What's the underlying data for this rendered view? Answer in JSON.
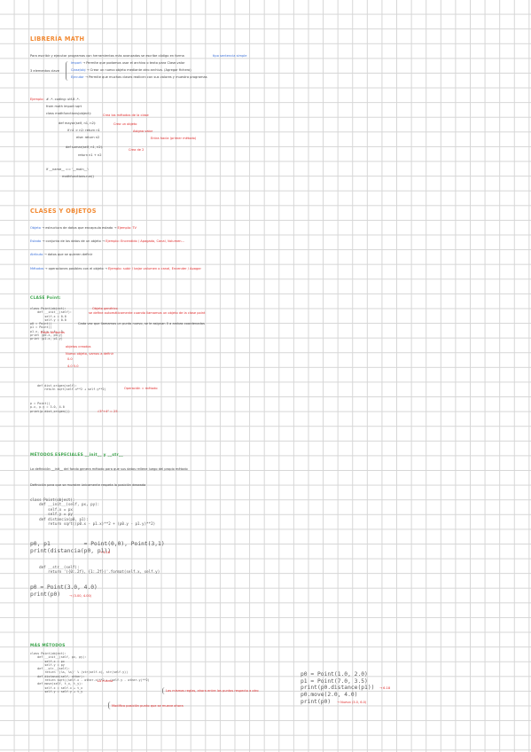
{
  "s1": {
    "title": "LIBRERÍA MATH",
    "intro": "Para escribir y ejecutar programas con herramientas más avanzadas se escribe código en forma",
    "intro_note": "tipo sentencia simple",
    "modules_label": "3 elementos clave",
    "modules": [
      {
        "name": "Import",
        "desc": "Permite que podamos usar el archivo o texto para Clase-valor"
      },
      {
        "name": "Clase/obj",
        "desc": "Crear un nuevo objeto mediante otro archivo. (Agregar fichero)"
      },
      {
        "name": "Ejecutar",
        "desc": "Permite que muchas clases realicen con sus valores y muestra programas"
      }
    ],
    "example_label": "Ejemplo:",
    "example_lines": [
      "# -*- coding: utf-8 -*-",
      "from math import sqrt",
      "class mathfunctions(object):",
      "def mayor(self, n1, n2):",
      "if n1 > n2: return n1",
      "else: return n2",
      "def sumar(self, n1, n2):",
      "return n1 + n2",
      "if __name__ == '__main__':",
      "mathfunctions.run()"
    ],
    "example_notes": [
      "Crea los métodos de la clase",
      "Crea un objeto",
      "Asigna valor",
      "Entra hacia (primer método)",
      "Crea de 2"
    ]
  },
  "s2": {
    "title": "CLASES Y OBJETOS",
    "rows": [
      {
        "term": "Objeto",
        "desc": "estructura de datos que encapsula estado",
        "example": "Ejemplo: TV"
      },
      {
        "term": "Estado",
        "desc": "conjunto de los datos de un objeto",
        "example": "Ejemplo: Encendido / Apagado, Canal, Volumen..."
      },
      {
        "term": "Atributo",
        "desc": "datos que se quieren definir",
        "example": ""
      },
      {
        "term": "Métodos",
        "desc": "operaciones posibles con el objeto",
        "example": "Ejemplo: subir / bajar volumen o canal, Encender / Apagar"
      }
    ]
  },
  "s3": {
    "title": "CLASE Point:",
    "code1": [
      "class Point(object):",
      "    def __init__(self):",
      "        self.x = 0.0",
      "        self.y = 0.0",
      "",
      "p0 = Point()",
      "p1 = Point()",
      "p1.x, p1.y = 4., 5.",
      "print (p0.x, p0.y)",
      "print (p1.x, p1.y)"
    ],
    "notes1": [
      "Objeto genérico",
      "se define automáticamente cuando llamamos un objeto de la clase point",
      "Cada vez que llamamos un punto nuevo, se le asignan 0 a ambas coordenadas",
      "Estos atributos",
      "objetos creados",
      "Nuevo objeto, vamos a definir",
      "0.0",
      "4.0 5.0"
    ],
    "code2": [
      "def dist_origen(self):",
      "    return sqrt(self.x**2 + self.y**2)"
    ],
    "note2": "Operación = método",
    "code3": [
      "p = Point()",
      "p.x, p.y = 3.0, 4.0",
      "print(p.dist_origen())"
    ],
    "note3": "√3²+4² = 25"
  },
  "s4": {
    "title": "MÉTODOS ESPECIALES __init__ y __str__",
    "line1": "La definición __init__ del fondo genera método para que sus datos rellene luego del propio método",
    "line2": "Definición para que se muestre únicamente respeta la posición deseada",
    "code": [
      "class Point(object):",
      "    def __init__(self, px, py):",
      "        self.x = px",
      "        self.y = py",
      "",
      "    def distancia(p0, p1):",
      "        return sqrt((p0.x - p1.x)**2 + (p0.y - p1.y)**2)",
      "",
      "p0, p1          = Point(0,0), Point(3,1)",
      "print(distancia(p0, p1))",
      "",
      "    def __str__(self):",
      "        return '({0:.2f}, {1:.2f})'.format(self.x, self.y)",
      "",
      "p0 = Point(3.0, 4.0)",
      "print(p0)"
    ],
    "out1": "3.16",
    "out2": "(3.00, 4.00)"
  },
  "s5": {
    "title": "MÁS MÉTODOS",
    "code_left": [
      "class Point(object):",
      "    def __init__(self, px, py):",
      "        self.x = px",
      "        self.y = py",
      "",
      "    def __str__(self):",
      "        return '(%s, %s)' % (str(self.x), str(self.y))",
      "",
      "    def distance(self, other):",
      "        return sqrt((self.x - other.x)**2 + (self.y - other.y)**2)",
      "",
      "    def move(self, t_x, t_y):",
      "        self.x = self.x + t_x",
      "        self.y = self.y + t_y"
    ],
    "notes_left": [
      "Lo mismo",
      "Las mismas reglas, ahora entre los puntos respecto a otro",
      "Modifica posición punto que se mueve ahora"
    ],
    "code_right": [
      "p0 = Point(1.0, 2.0)",
      "p1 = Point(7.0, 3.5)",
      "print(p0.distance(p1))",
      "p0.move(2.0, 4.0)",
      "print(p0)"
    ],
    "out1": "6.18",
    "out2": "Nuevo (3.0, 6.0)"
  },
  "colors": {
    "orange": "#f28a33",
    "green": "#3aa34a",
    "red": "#e02b2b",
    "blue": "#3a6fd8"
  }
}
